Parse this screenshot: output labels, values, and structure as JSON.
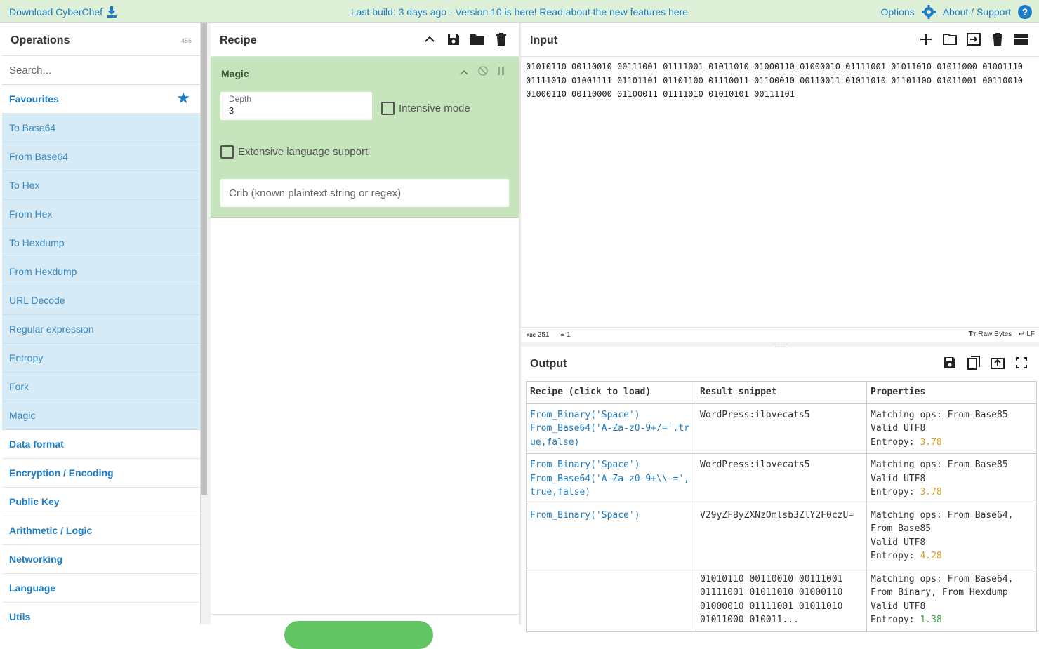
{
  "banner": {
    "download": "Download CyberChef",
    "message": "Last build: 3 days ago - Version 10 is here! Read about the new features here",
    "options": "Options",
    "about": "About / Support"
  },
  "operations": {
    "title": "Operations",
    "count": "456",
    "search_placeholder": "Search...",
    "favourites": "Favourites",
    "items": [
      "To Base64",
      "From Base64",
      "To Hex",
      "From Hex",
      "To Hexdump",
      "From Hexdump",
      "URL Decode",
      "Regular expression",
      "Entropy",
      "Fork",
      "Magic"
    ],
    "categories": [
      "Data format",
      "Encryption / Encoding",
      "Public Key",
      "Arithmetic / Logic",
      "Networking",
      "Language",
      "Utils"
    ]
  },
  "recipe": {
    "title": "Recipe",
    "magic": {
      "title": "Magic",
      "depth_label": "Depth",
      "depth_value": "3",
      "intensive_label": "Intensive mode",
      "extensive_label": "Extensive language support",
      "crib_placeholder": "Crib (known plaintext string or regex)"
    }
  },
  "input": {
    "title": "Input",
    "text": "01010110 00110010 00111001 01111001 01011010 01000110 01000010 01111001 01011010 01011000 01001110 01111010 01001111 01101101 01101100 01110011 01100010 00110011 01011010 01101100 01011001 00110010 01000110 00110000 01100011 01111010 01010101 00111101",
    "status": {
      "chars_label": "ABC",
      "chars": "251",
      "lines": "1",
      "encoding": "Raw Bytes",
      "eol": "LF"
    }
  },
  "output": {
    "title": "Output",
    "headers": [
      "Recipe (click to load)",
      "Result snippet",
      "Properties"
    ],
    "rows": [
      {
        "recipe": "From_Binary('Space')\nFrom_Base64('A-Za-z0-9+/=',true,false)",
        "snippet": "WordPress:ilovecats5",
        "props": "Matching ops: From Base85\nValid UTF8\nEntropy: ",
        "entropy": "3.78",
        "entropy_color": "orange"
      },
      {
        "recipe": "From_Binary('Space')\nFrom_Base64('A-Za-z0-9+\\\\-=',true,false)",
        "snippet": "WordPress:ilovecats5",
        "props": "Matching ops: From Base85\nValid UTF8\nEntropy: ",
        "entropy": "3.78",
        "entropy_color": "orange"
      },
      {
        "recipe": "From_Binary('Space')",
        "snippet": "V29yZFByZXNzOmlsb3ZlY2F0czU=",
        "props": "Matching ops: From Base64,\nFrom Base85\nValid UTF8\nEntropy: ",
        "entropy": "4.28",
        "entropy_color": "orange"
      },
      {
        "recipe": "",
        "snippet": "01010110 00110010 00111001\n01111001 01011010 01000110\n01000010 01111001 01011010\n01011000 010011...",
        "props": "Matching ops: From Base64,\nFrom Binary, From Hexdump\nValid UTF8\nEntropy: ",
        "entropy": "1.38",
        "entropy_color": "green"
      }
    ]
  },
  "colors": {
    "accent": "#1c7cc6",
    "banner": "#dff0d8",
    "favourite_bg": "#d7ebf6",
    "magic_bg": "#c7e5bd",
    "bake": "#62c462"
  }
}
